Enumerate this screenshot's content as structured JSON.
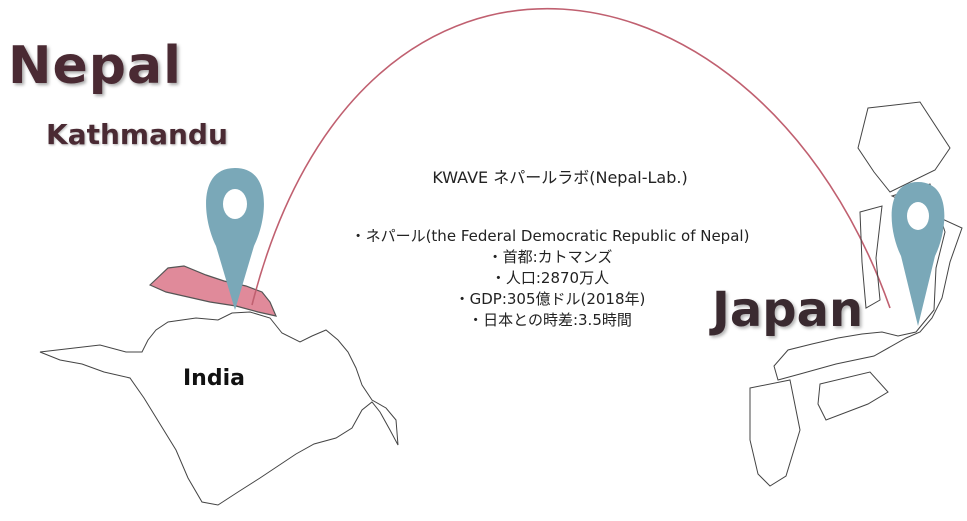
{
  "labels": {
    "country_origin": "Nepal",
    "capital": "Kathmandu",
    "country_destination": "Japan",
    "neighbor": "India"
  },
  "info": {
    "title": "KWAVE ネパールラボ(Nepal-Lab.)",
    "facts": [
      "・ネパール(the Federal Democratic Republic of Nepal)",
      "・首都:カトマンズ",
      "・人口:2870万人",
      "・GDP:305億ドル(2018年)",
      "・日本との時差:3.5時間"
    ]
  },
  "colors": {
    "nepal_fill": "#e08a9a",
    "pin": "#7aa8b8",
    "arc": "#c06070",
    "label_text": "#4a2a33"
  }
}
